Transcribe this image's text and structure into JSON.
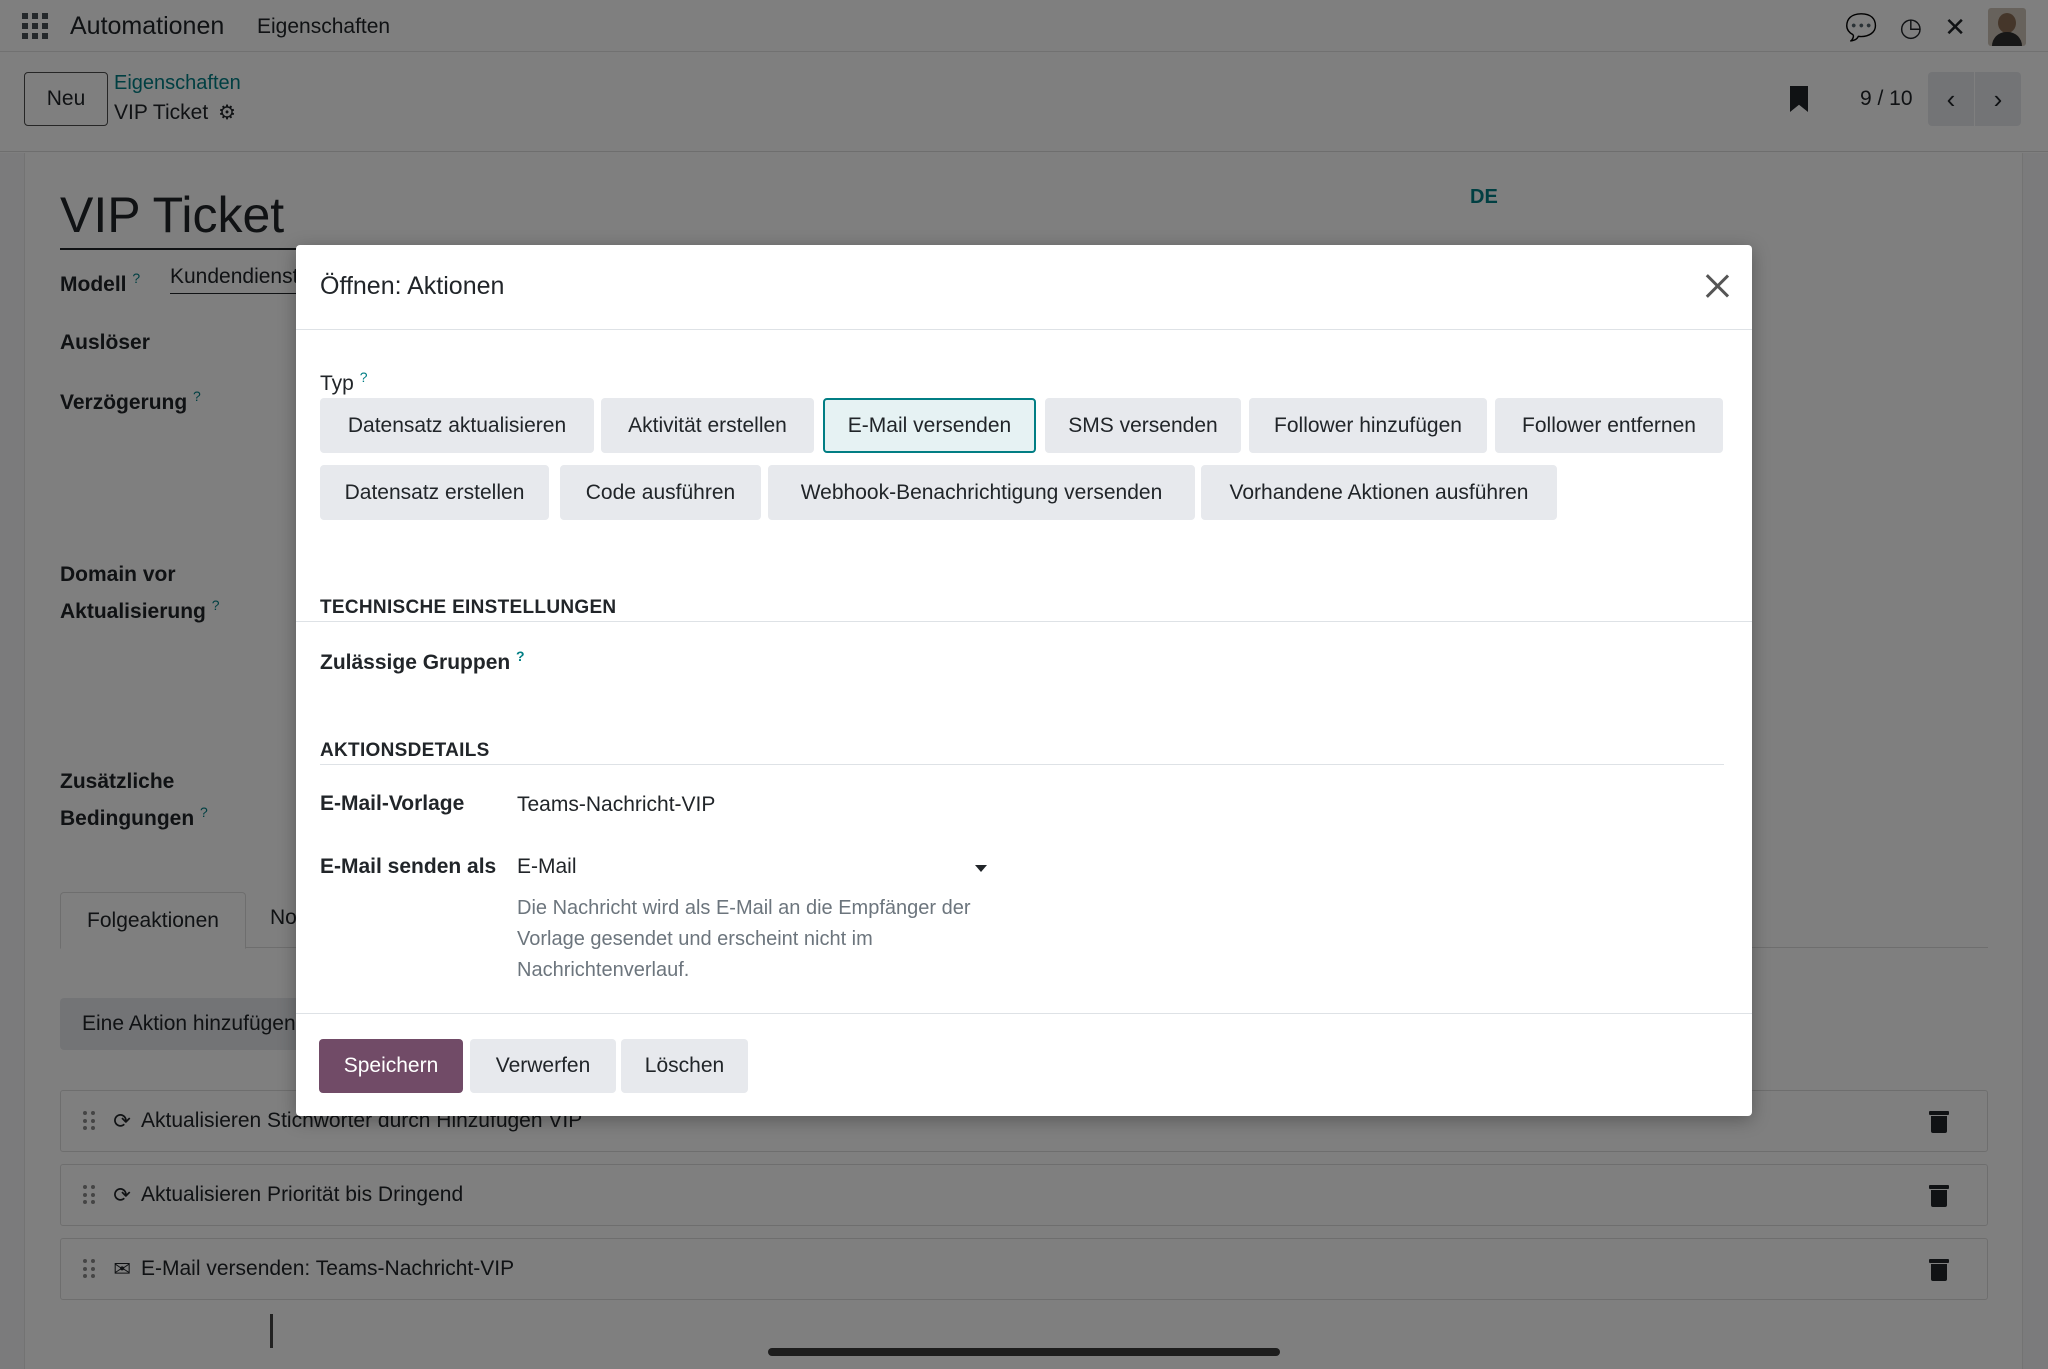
{
  "topbar": {
    "app_name": "Automationen",
    "menu_item": "Eigenschaften",
    "icons": [
      "chat-icon",
      "clock-icon",
      "tools-icon",
      "avatar"
    ]
  },
  "control": {
    "new_label": "Neu",
    "breadcrumb_parent": "Eigenschaften",
    "breadcrumb_current": "VIP Ticket",
    "pager": "9 / 10"
  },
  "record": {
    "title": "VIP Ticket",
    "lang": "DE",
    "labels": {
      "model": "Modell",
      "trigger": "Auslöser",
      "delay": "Verzögerung",
      "domain_1": "Domain vor",
      "domain_2": "Aktualisierung",
      "cond_1": "Zusätzliche",
      "cond_2": "Bedingungen"
    },
    "model_value": "Kundendienst",
    "help_marker": "?"
  },
  "tabs": {
    "active": "Folgeaktionen",
    "other": "No"
  },
  "actions": {
    "add_label": "Eine Aktion hinzufügen",
    "rows": [
      {
        "icon": "refresh-icon",
        "text": "Aktualisieren Stichwörter durch Hinzufügen VIP"
      },
      {
        "icon": "refresh-icon",
        "text": "Aktualisieren Priorität bis Dringend"
      },
      {
        "icon": "envelope-icon",
        "text": "E-Mail versenden: Teams-Nachricht-VIP"
      }
    ]
  },
  "modal": {
    "title": "Öffnen: Aktionen",
    "type_label": "Typ",
    "type_options": [
      "Datensatz aktualisieren",
      "Aktivität erstellen",
      "E-Mail versenden",
      "SMS versenden",
      "Follower hinzufügen",
      "Follower entfernen",
      "Datensatz erstellen",
      "Code ausführen",
      "Webhook-Benachrichtigung versenden",
      "Vorhandene Aktionen ausführen"
    ],
    "selected_type": "E-Mail versenden",
    "tech_section": "TECHNISCHE EINSTELLUNGEN",
    "groups_label": "Zulässige Gruppen",
    "details_section": "AKTIONSDETAILS",
    "template_label": "E-Mail-Vorlage",
    "template_value": "Teams-Nachricht-VIP",
    "send_as_label": "E-Mail senden als",
    "send_as_value": "E-Mail",
    "send_as_help": "Die Nachricht wird als E-Mail an die Empfänger der Vorlage gesendet und erscheint nicht im Nachrichtenverlauf.",
    "buttons": {
      "save": "Speichern",
      "discard": "Verwerfen",
      "delete": "Löschen"
    }
  },
  "colors": {
    "primary": "#714b67",
    "accent": "#017e84",
    "button_bg": "#e7e9ed"
  }
}
